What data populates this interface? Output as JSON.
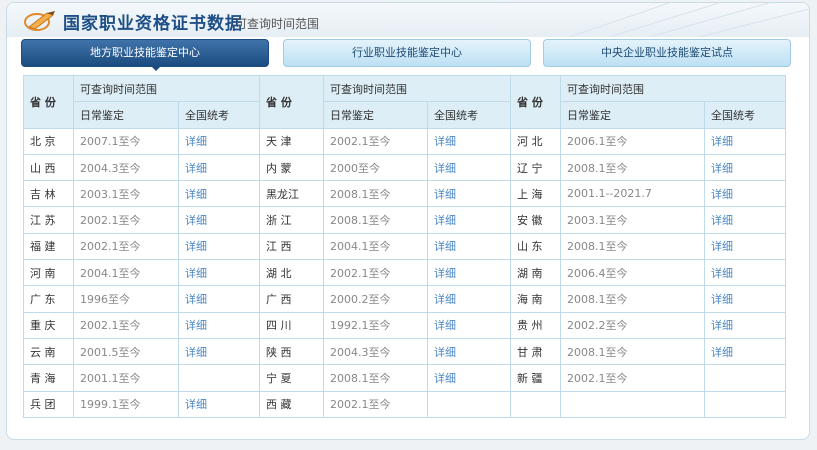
{
  "header": {
    "title": "国家职业资格证书数据",
    "subtitle": "可查询时间范围"
  },
  "tabs": [
    {
      "label": "地方职业技能鉴定中心",
      "active": true
    },
    {
      "label": "行业职业技能鉴定中心",
      "active": false
    },
    {
      "label": "中央企业职业技能鉴定试点",
      "active": false
    }
  ],
  "table": {
    "header": {
      "province": "省 份",
      "range": "可查询时间范围",
      "daily": "日常鉴定",
      "national": "全国统考"
    },
    "columns": [
      [
        {
          "province": "北 京",
          "daily": "2007.1至今",
          "national": "详细"
        },
        {
          "province": "山 西",
          "daily": "2004.3至今",
          "national": "详细"
        },
        {
          "province": "吉 林",
          "daily": "2003.1至今",
          "national": "详细"
        },
        {
          "province": "江 苏",
          "daily": "2002.1至今",
          "national": "详细"
        },
        {
          "province": "福 建",
          "daily": "2002.1至今",
          "national": "详细"
        },
        {
          "province": "河 南",
          "daily": "2004.1至今",
          "national": "详细"
        },
        {
          "province": "广 东",
          "daily": "1996至今",
          "national": "详细"
        },
        {
          "province": "重 庆",
          "daily": "2002.1至今",
          "national": "详细"
        },
        {
          "province": "云 南",
          "daily": "2001.5至今",
          "national": "详细"
        },
        {
          "province": "青 海",
          "daily": "2001.1至今",
          "national": ""
        },
        {
          "province": "兵 团",
          "daily": "1999.1至今",
          "national": "详细"
        }
      ],
      [
        {
          "province": "天 津",
          "daily": "2002.1至今",
          "national": "详细"
        },
        {
          "province": "内 蒙",
          "daily": "2000至今",
          "national": "详细"
        },
        {
          "province": "黑龙江",
          "daily": "2008.1至今",
          "national": "详细"
        },
        {
          "province": "浙 江",
          "daily": "2008.1至今",
          "national": "详细"
        },
        {
          "province": "江 西",
          "daily": "2004.1至今",
          "national": "详细"
        },
        {
          "province": "湖 北",
          "daily": "2002.1至今",
          "national": "详细"
        },
        {
          "province": "广 西",
          "daily": "2000.2至今",
          "national": "详细"
        },
        {
          "province": "四 川",
          "daily": "1992.1至今",
          "national": "详细"
        },
        {
          "province": "陕 西",
          "daily": "2004.3至今",
          "national": "详细"
        },
        {
          "province": "宁 夏",
          "daily": "2008.1至今",
          "national": "详细"
        },
        {
          "province": "西 藏",
          "daily": "2002.1至今",
          "national": ""
        }
      ],
      [
        {
          "province": "河 北",
          "daily": "2006.1至今",
          "national": "详细"
        },
        {
          "province": "辽 宁",
          "daily": "2008.1至今",
          "national": "详细"
        },
        {
          "province": "上 海",
          "daily": "2001.1--2021.7",
          "national": "详细"
        },
        {
          "province": "安 徽",
          "daily": "2003.1至今",
          "national": "详细"
        },
        {
          "province": "山 东",
          "daily": "2008.1至今",
          "national": "详细"
        },
        {
          "province": "湖 南",
          "daily": "2006.4至今",
          "national": "详细"
        },
        {
          "province": "海 南",
          "daily": "2008.1至今",
          "national": "详细"
        },
        {
          "province": "贵 州",
          "daily": "2002.2至今",
          "national": "详细"
        },
        {
          "province": "甘 肃",
          "daily": "2008.1至今",
          "national": "详细"
        },
        {
          "province": "新 疆",
          "daily": "2002.1至今",
          "national": ""
        },
        {
          "province": "",
          "daily": "",
          "national": ""
        }
      ]
    ]
  },
  "colors": {
    "header_blue": "#1e4f86",
    "active_tab": "#1c4c80",
    "inactive_tab": "#bde0f3",
    "table_header_bg": "#ddeef6",
    "link": "#4a86c5",
    "border": "#bfdbe9"
  }
}
